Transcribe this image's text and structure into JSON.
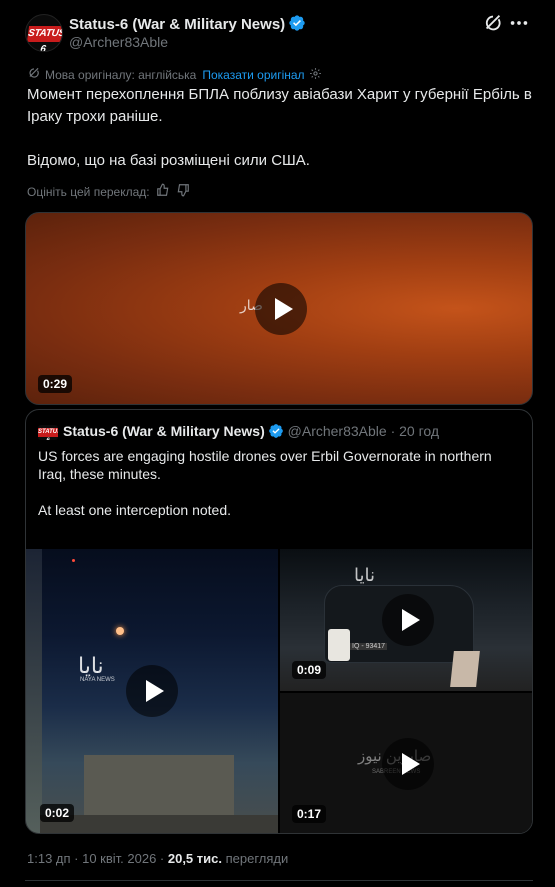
{
  "author": {
    "name": "Status-6 (War & Military News)",
    "handle": "@Archer83Able",
    "avatar_text": "STATUS 6"
  },
  "translation": {
    "language_label": "Мова оригіналу: англійська",
    "show_original": "Показати оригінал"
  },
  "tweet": {
    "paragraphs": [
      "Момент перехоплення БПЛА поблизу авіабази Харит у губернії Ербіль в Іраку трохи раніше.",
      "Відомо, що на базі розміщені сили США."
    ]
  },
  "rate_label": "Оцініть цей переклад:",
  "main_video": {
    "duration": "0:29",
    "watermark": "صار"
  },
  "quote": {
    "avatar_text": "STATUS 6",
    "name": "Status-6 (War & Military News)",
    "handle": "@Archer83Able",
    "time": "· 20 год",
    "paragraphs": [
      "US forces are engaging hostile drones over Erbil Governorate in northern Iraq, these minutes.",
      "At least one interception noted.",
      "..."
    ],
    "media": [
      {
        "duration": "0:02",
        "watermark": "نايا",
        "watermark_sub": "NAYA NEWS"
      },
      {
        "duration": "0:09",
        "watermark": "نايا",
        "watermark_sub": "IQ - 93417"
      },
      {
        "duration": "0:17",
        "watermark": "صابرين نيوز",
        "watermark_sub": "SABREEN NEWS"
      }
    ]
  },
  "footer": {
    "time": "1:13 дп · 10 квіт. 2026 · ",
    "views_count": "20,5 тис.",
    "views_label": " перегляди"
  },
  "colors": {
    "accent": "#1d9bf0",
    "muted": "#71767b",
    "text": "#e7e9ea",
    "border": "#2f3336",
    "background": "#000000"
  },
  "icons": [
    "verified-badge-icon",
    "grok-icon",
    "more-options-icon",
    "translate-icon",
    "settings-icon",
    "thumbs-up-icon",
    "thumbs-down-icon",
    "play-icon"
  ]
}
